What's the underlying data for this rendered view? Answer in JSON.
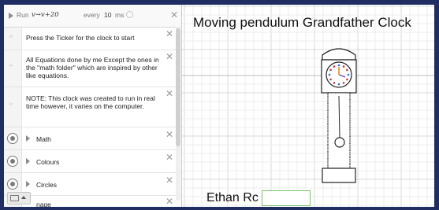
{
  "ticker": {
    "run_label": "Run",
    "expression": "v→v+20",
    "every_label": "every",
    "interval": "10",
    "unit": "ms"
  },
  "notes": [
    {
      "text": "Press the Ticker for the clock to start"
    },
    {
      "text": "All Equations done by me Except the ones in the \"math folder\" which are inspired by other like equations."
    },
    {
      "text": "NOTE: This clock was created to run in real time however, it varies on the computer."
    }
  ],
  "folders": [
    {
      "label": "Math"
    },
    {
      "label": "Colours"
    },
    {
      "label": "Circles"
    },
    {
      "label": "nage"
    }
  ],
  "graph": {
    "title": "Moving pendulum Grandfather Clock",
    "author_text": "Ethan Rc"
  },
  "colors": {
    "page_background": "#1f2d63",
    "grid_minor": "#eeeeee",
    "grid_major": "#d8d8d8",
    "axis": "#bdbdbd",
    "clock_stroke": "#222222",
    "clock_face_tick": "#c43a3a",
    "clock_face_tick_alt": "#2c6bd4",
    "clock_hand_orange": "#e58a1f",
    "clock_hand_purple": "#7a3fc4",
    "author_box_border": "#7cc16a"
  },
  "icons": {
    "ticker_close": "close-icon",
    "note_close": "close-icon",
    "folder_toggle": "caret-right-icon",
    "folder_visibility": "hidden-circle-icon",
    "keypad": "keyboard-icon",
    "keypad_toggle": "caret-up-icon",
    "settings": "gear-icon",
    "note_marker": "quote-icon",
    "ticker_play": "play-icon"
  }
}
